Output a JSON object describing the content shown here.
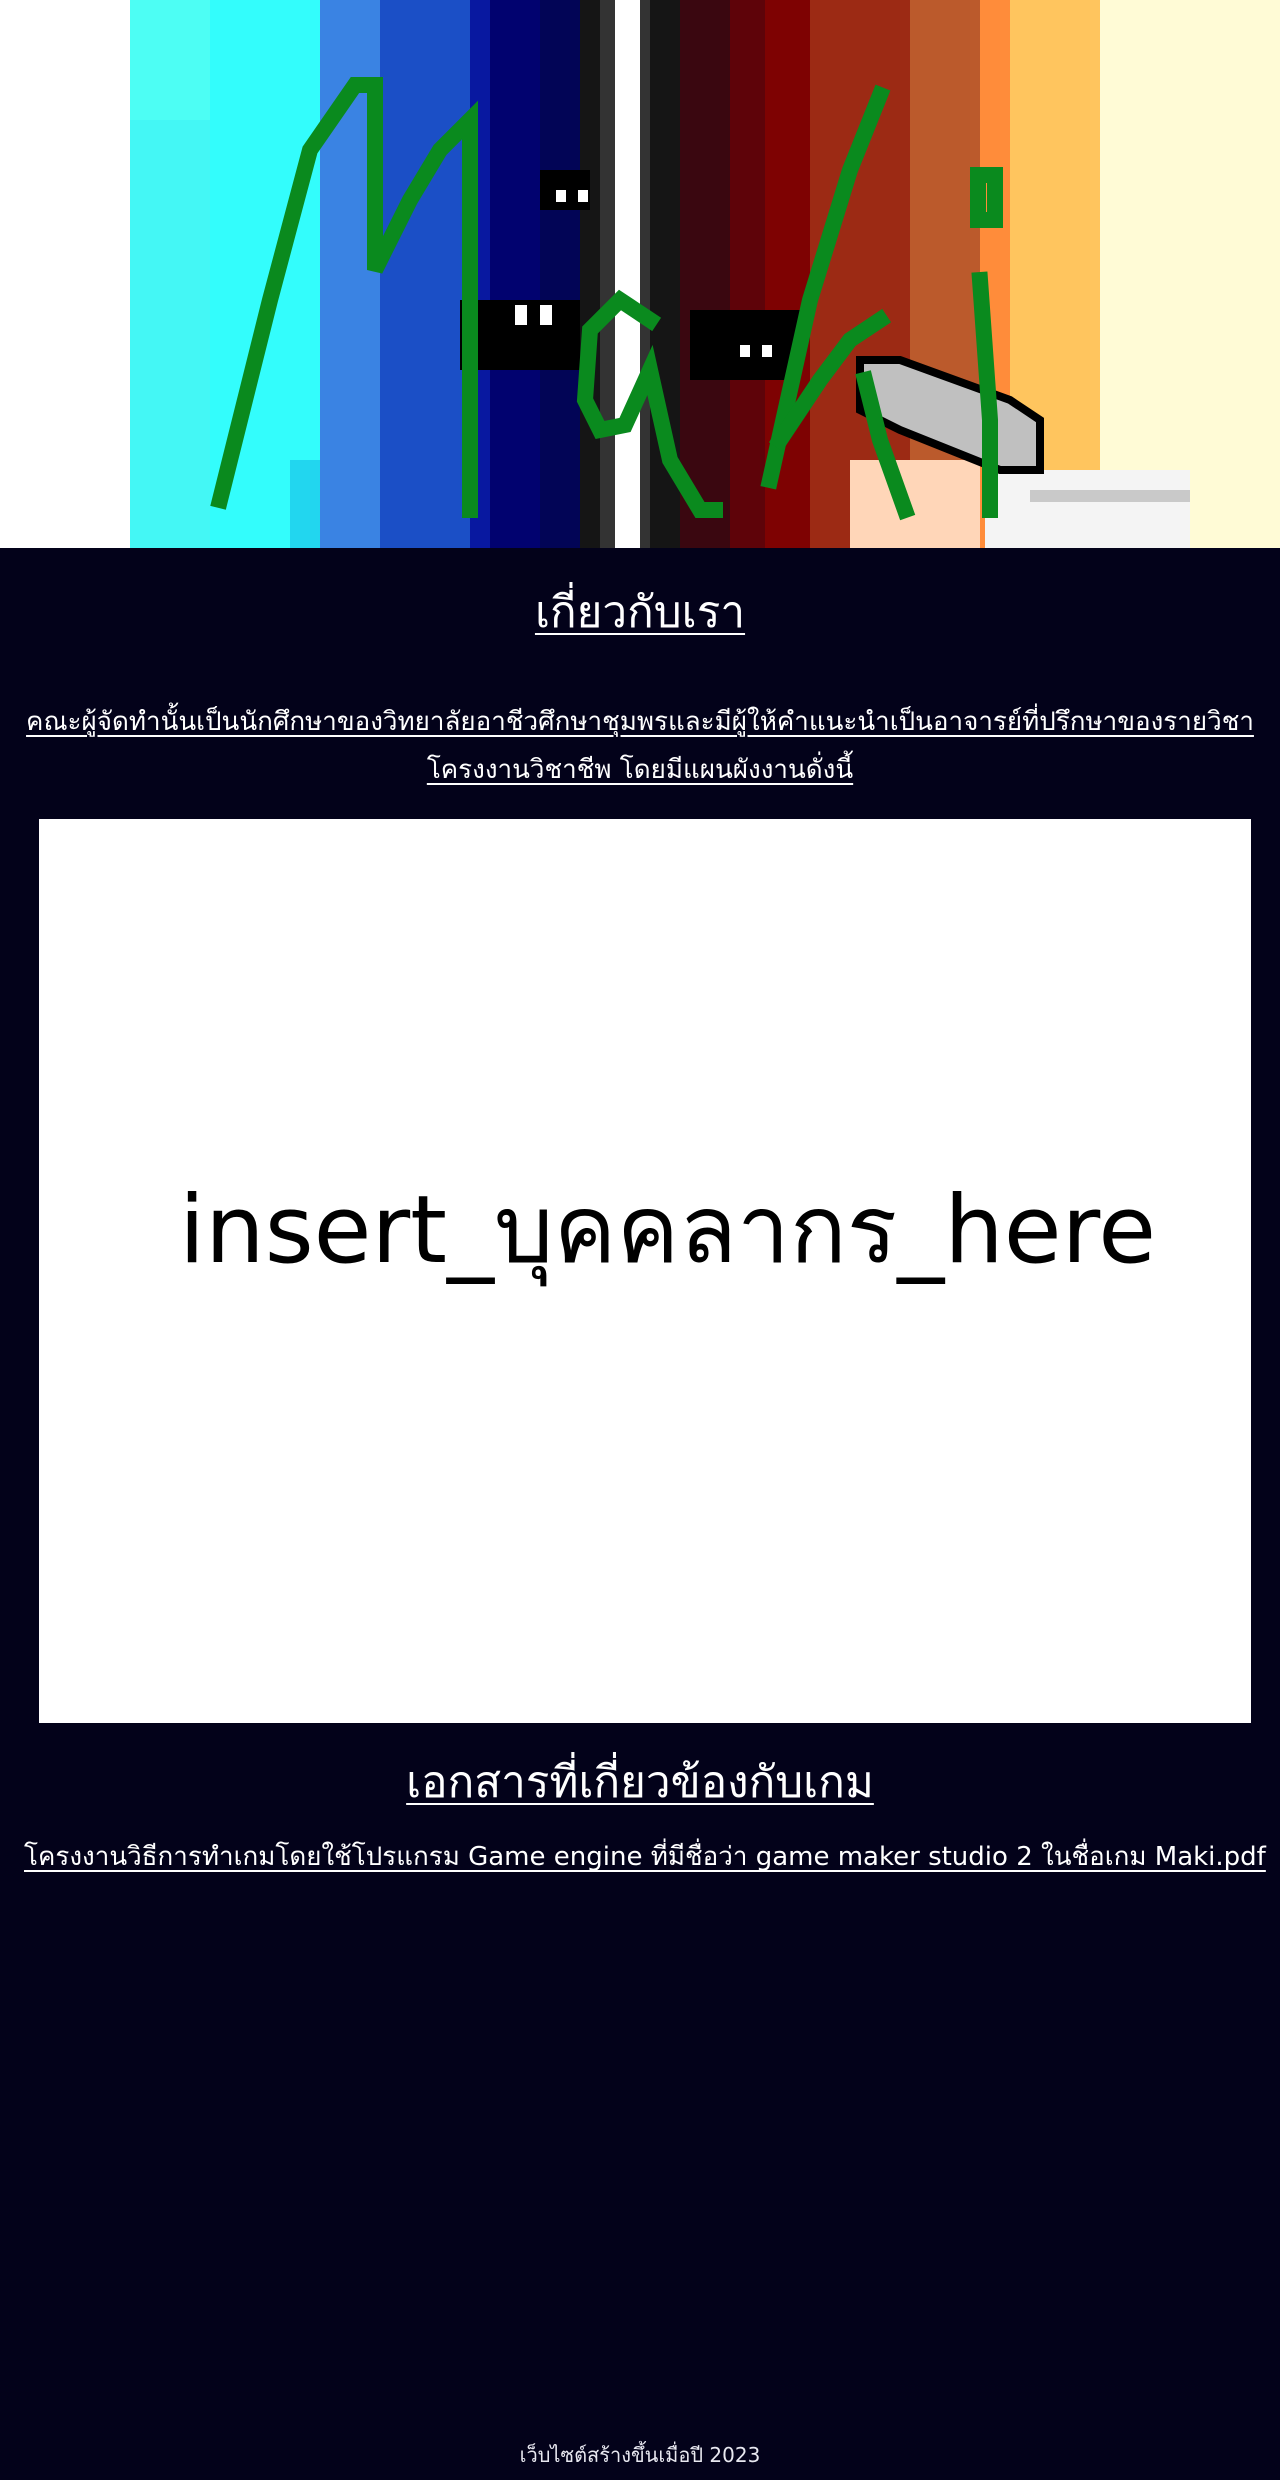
{
  "banner": {
    "logo_text": "Maki",
    "colors": {
      "cyan": "#4dfef4",
      "blue": "#1b4fc6",
      "navy": "#01026f",
      "dark_red": "#7e0202",
      "orange": "#ff8c3a",
      "cream": "#fffbd6",
      "logo_green": "#0a8a1e"
    }
  },
  "about": {
    "title": "เกี่ยวกับเรา",
    "text": "คณะผู้จัดทำนั้นเป็นนักศึกษาของวิทยาลัยอาชีวศึกษาชุมพรและมีผู้ให้คำแนะนำเป็นอาจารย์ที่ปรึกษาของรายวิชาโครงงานวิชาชีพ โดยมีแผนผังงานดั่งนี้"
  },
  "staff": {
    "placeholder": "insert_บุคคลากร_here"
  },
  "documents": {
    "title": "เอกสารที่เกี่ยวข้องกับเกม",
    "links": [
      "โครงงานวิธีการทำเกมโดยใช้โปรแกรม Game engine ที่มีชื่อว่า game maker studio 2 ในชื่อเกม Maki.pdf"
    ]
  },
  "footer": {
    "text": "เว็บไซต์สร้างขึ้นเมื่อปี 2023"
  },
  "colors": {
    "page_background": "#03021a",
    "text": "#ffffff"
  }
}
